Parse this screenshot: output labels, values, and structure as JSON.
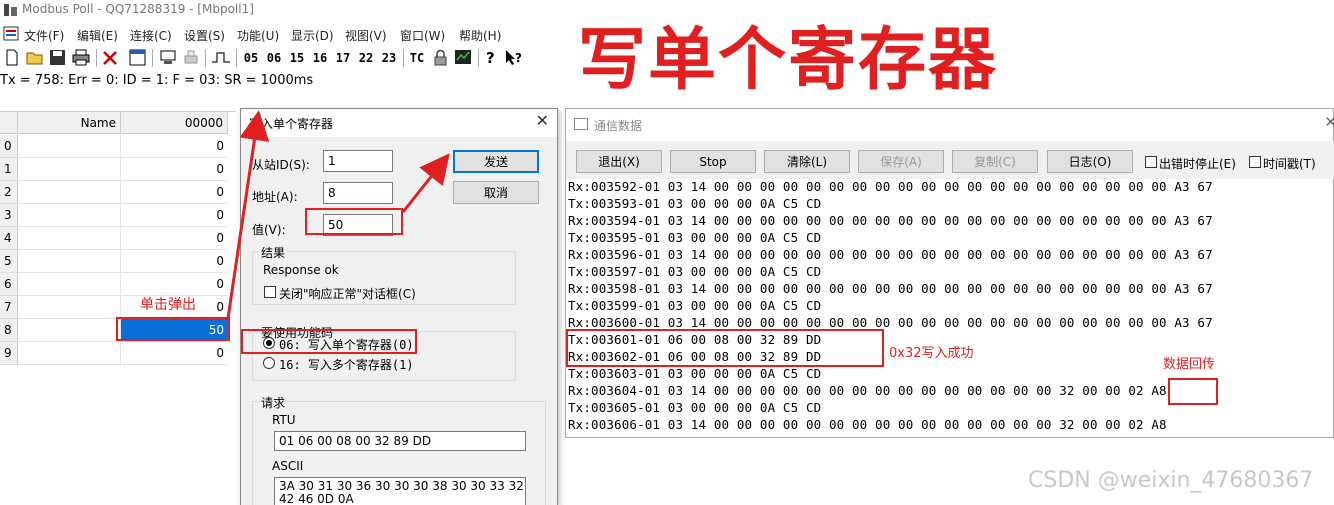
{
  "app": {
    "title": "Modbus Poll - QQ71288319 - [Mbpoll1]",
    "menu": [
      "文件(F)",
      "编辑(E)",
      "连接(C)",
      "设置(S)",
      "功能(U)",
      "显示(D)",
      "视图(V)",
      "窗口(W)",
      "帮助(H)"
    ],
    "function_codes": [
      "05",
      "06",
      "15",
      "16",
      "17",
      "22",
      "23",
      "TC"
    ],
    "status_line": "Tx = 758: Err = 0: ID = 1: F = 03: SR = 1000ms"
  },
  "annotation": {
    "heading": "写单个寄存器",
    "click_popup": "单击弹出",
    "write_success": "0x32写入成功",
    "echo": "数据回传"
  },
  "grid": {
    "header_name": "Name",
    "header_value": "00000",
    "rows": [
      {
        "num": "0",
        "value": "0"
      },
      {
        "num": "1",
        "value": "0"
      },
      {
        "num": "2",
        "value": "0"
      },
      {
        "num": "3",
        "value": "0"
      },
      {
        "num": "4",
        "value": "0"
      },
      {
        "num": "5",
        "value": "0"
      },
      {
        "num": "6",
        "value": "0"
      },
      {
        "num": "7",
        "value": "0"
      },
      {
        "num": "8",
        "value": "50"
      },
      {
        "num": "9",
        "value": "0"
      }
    ]
  },
  "dialog": {
    "title": "写入单个寄存器",
    "slave_label": "从站ID(S):",
    "slave_value": "1",
    "address_label": "地址(A):",
    "address_value": "8",
    "value_label": "值(V):",
    "value_value": "50",
    "send_button": "发送",
    "cancel_button": "取消",
    "result_group": "结果",
    "result_text": "Response ok",
    "close_checkbox": "关闭\"响应正常\"对话框(C)",
    "func_group": "要使用功能码",
    "func_06": "06: 写入单个寄存器(0)",
    "func_16": "16: 写入多个寄存器(1)",
    "request_group": "请求",
    "rtu_label": "RTU",
    "rtu_value": "01 06 00 08 00 32 89 DD",
    "ascii_label": "ASCII",
    "ascii_line1": "3A 30 31 30 36 30 30 30 38 30 30 33 32",
    "ascii_line2": "42 46 0D 0A"
  },
  "traffic": {
    "title": "通信数据",
    "buttons": {
      "exit": "退出(X)",
      "stop": "Stop",
      "clear": "清除(L)",
      "save": "保存(A)",
      "copy": "复制(C)",
      "log": "日志(O)"
    },
    "stop_on_error": "出错时停止(E)",
    "timestamp": "时间戳(T)",
    "lines": [
      "Rx:003592-01 03 14 00 00 00 00 00 00 00 00 00 00 00 00 00 00 00 00 00 00 00 00 A3 67",
      "Tx:003593-01 03 00 00 00 0A C5 CD",
      "Rx:003594-01 03 14 00 00 00 00 00 00 00 00 00 00 00 00 00 00 00 00 00 00 00 00 A3 67",
      "Tx:003595-01 03 00 00 00 0A C5 CD",
      "Rx:003596-01 03 14 00 00 00 00 00 00 00 00 00 00 00 00 00 00 00 00 00 00 00 00 A3 67",
      "Tx:003597-01 03 00 00 00 0A C5 CD",
      "Rx:003598-01 03 14 00 00 00 00 00 00 00 00 00 00 00 00 00 00 00 00 00 00 00 00 A3 67",
      "Tx:003599-01 03 00 00 00 0A C5 CD",
      "Rx:003600-01 03 14 00 00 00 00 00 00 00 00 00 00 00 00 00 00 00 00 00 00 00 00 A3 67",
      "Tx:003601-01 06 00 08 00 32 89 DD",
      "Rx:003602-01 06 00 08 00 32 89 DD",
      "Tx:003603-01 03 00 00 00 0A C5 CD",
      "Rx:003604-01 03 14 00 00 00 00 00 00 00 00 00 00 00 00 00 00 00 32 00 00 02 A8",
      "Tx:003605-01 03 00 00 00 0A C5 CD",
      "Rx:003606-01 03 14 00 00 00 00 00 00 00 00 00 00 00 00 00 00 00 32 00 00 02 A8"
    ]
  },
  "watermark": "CSDN @weixin_47680367",
  "colors": {
    "annotation_red": "#e02020",
    "selection_blue": "#0a6fd6",
    "default_button_border": "#0078d7"
  }
}
